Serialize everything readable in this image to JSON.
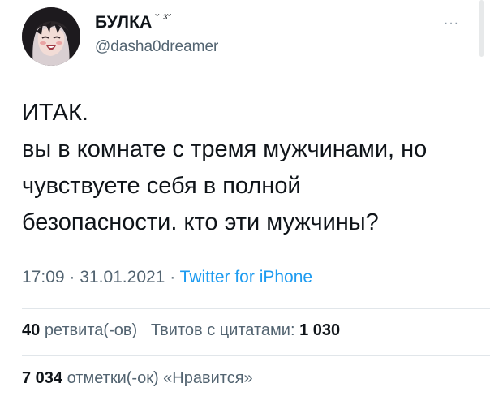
{
  "user": {
    "display_name": "БУЛКА",
    "display_emoticon": "˘ ³˘",
    "handle": "@dasha0dreamer"
  },
  "menu": {
    "more_label": "···"
  },
  "tweet": {
    "lines": [
      "ИТАК.",
      "вы в комнате с тремя мужчинами, но",
      "чувствуете себя в полной",
      "безопасности. кто эти мужчины?"
    ]
  },
  "meta": {
    "time": "17:09",
    "sep1": "·",
    "date": "31.01.2021",
    "sep2": "·",
    "source": "Twitter for iPhone"
  },
  "stats": {
    "retweets_count": "40",
    "retweets_label": "ретвита(-ов)",
    "quotes_label": "Твитов с цитатами:",
    "quotes_count": "1 030",
    "likes_count": "7 034",
    "likes_label": "отметки(-ок) «Нравится»"
  },
  "colors": {
    "text": "#0f1419",
    "secondary": "#536471",
    "link": "#1d9bf0",
    "divider": "#e1e6ea"
  }
}
